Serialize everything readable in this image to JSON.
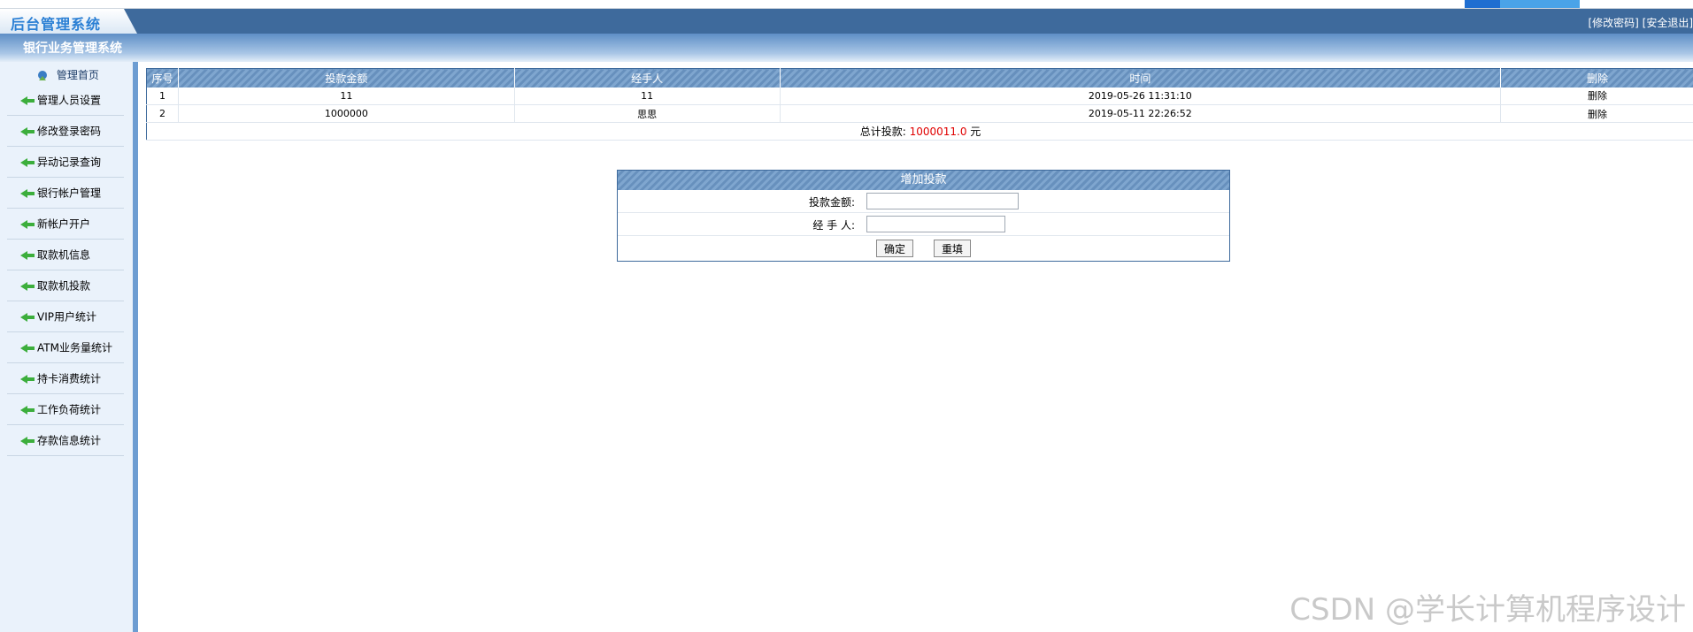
{
  "header": {
    "logo": "后台管理系统",
    "links": "[修改密码] [安全退出]"
  },
  "subheader": {
    "title": "银行业务管理系统"
  },
  "sidebar": {
    "home": "管理首页",
    "items": [
      {
        "label": "管理人员设置"
      },
      {
        "label": "修改登录密码"
      },
      {
        "label": "异动记录查询"
      },
      {
        "label": "银行帐户管理"
      },
      {
        "label": "新帐户开户"
      },
      {
        "label": "取款机信息"
      },
      {
        "label": "取款机投款"
      },
      {
        "label": "VIP用户统计"
      },
      {
        "label": "ATM业务量统计"
      },
      {
        "label": "持卡消费统计"
      },
      {
        "label": "工作负荷统计"
      },
      {
        "label": "存款信息统计"
      }
    ]
  },
  "table": {
    "headers": [
      "序号",
      "投款金额",
      "经手人",
      "时间",
      "删除"
    ],
    "rows": [
      {
        "no": "1",
        "amount": "11",
        "handler": "11",
        "time": "2019-05-26 11:31:10",
        "delete": "删除"
      },
      {
        "no": "2",
        "amount": "1000000",
        "handler": "思思",
        "time": "2019-05-11 22:26:52",
        "delete": "删除"
      }
    ],
    "total_label": "总计投款:",
    "total_value": "1000011.0",
    "total_unit": "元"
  },
  "form": {
    "title": "增加投款",
    "amount_label": "投款金额:",
    "handler_label": "经 手 人:",
    "amount_value": "",
    "handler_value": "",
    "confirm": "确定",
    "reset": "重填"
  },
  "watermark": "CSDN @学长计算机程序设计",
  "colors": {
    "header": "#3e6a9c",
    "accent": "#6790bd",
    "total": "#e00000"
  }
}
